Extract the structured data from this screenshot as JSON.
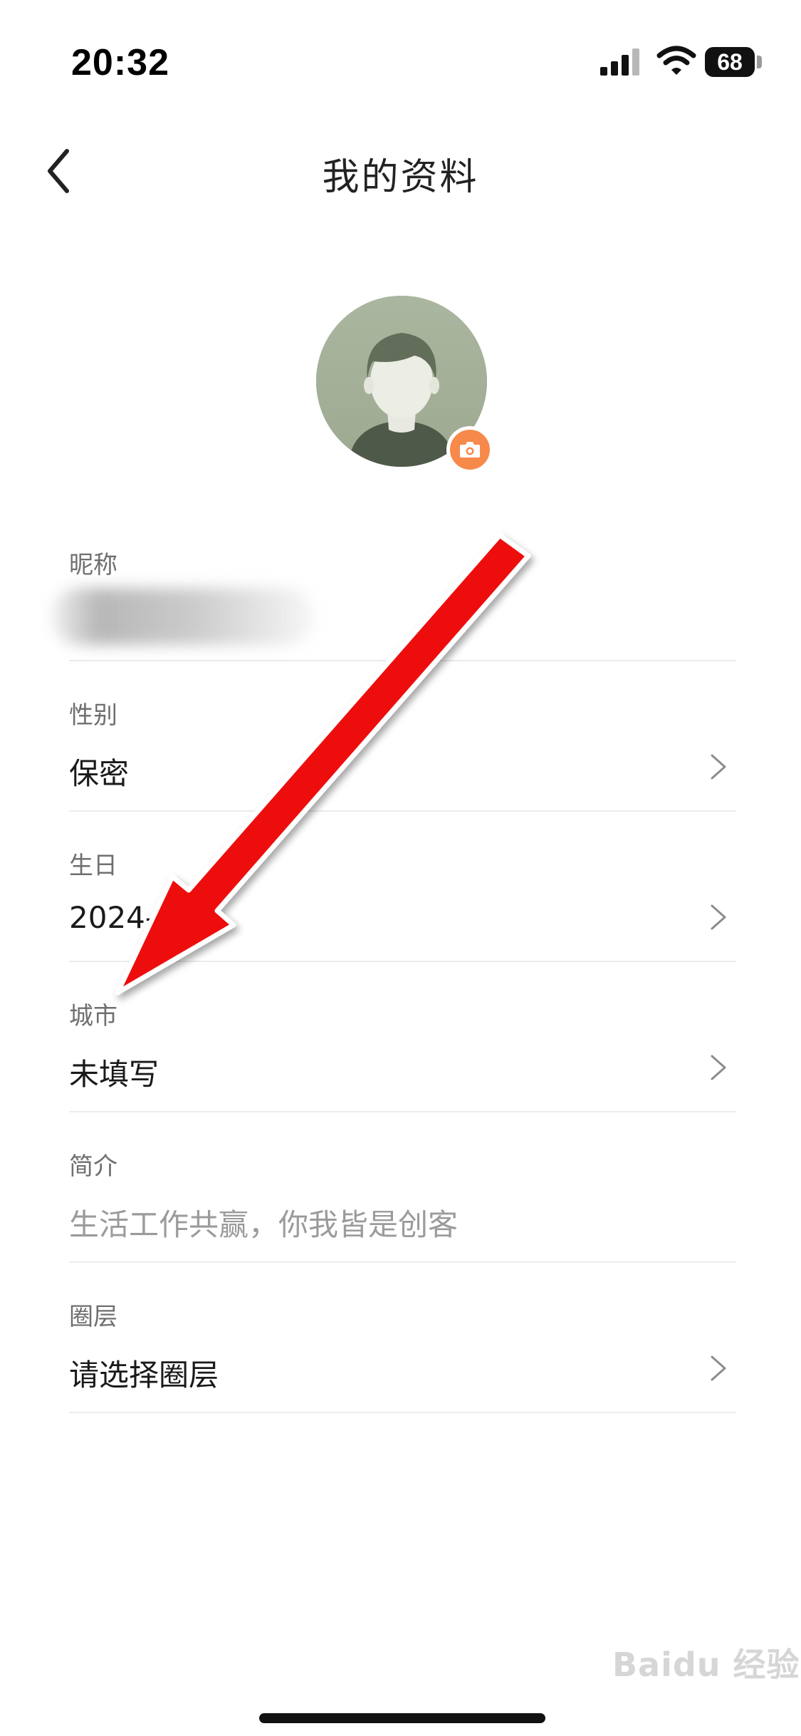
{
  "status_bar": {
    "time": "20:32",
    "battery": "68"
  },
  "nav": {
    "title": "我的资料"
  },
  "profile_rows": [
    {
      "label": "昵称",
      "value": ""
    },
    {
      "label": "性别",
      "value": "保密"
    },
    {
      "label": "生日",
      "value": "2024-  -14"
    },
    {
      "label": "城市",
      "value": "未填写"
    },
    {
      "label": "简介",
      "placeholder": "生活工作共赢，你我皆是创客"
    },
    {
      "label": "圈层",
      "value": "请选择圈层"
    }
  ],
  "watermark": "Baidu 经验",
  "colors": {
    "accent": "#f7894a",
    "arrow": "#ee1111",
    "divider": "#ececec"
  }
}
